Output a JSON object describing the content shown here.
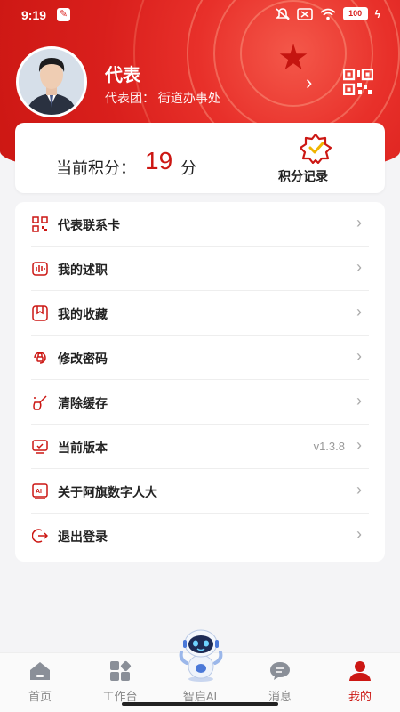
{
  "status_bar": {
    "time": "9:19",
    "battery": "100"
  },
  "profile": {
    "name": "代表",
    "team": "代表团：        街道办事处"
  },
  "points": {
    "label": "当前积分：",
    "value": "19",
    "unit": "分",
    "record_label": "积分记录"
  },
  "menu": {
    "items": [
      {
        "icon": "qr-card-icon",
        "label": "代表联系卡"
      },
      {
        "icon": "audio-wave-icon",
        "label": "我的述职"
      },
      {
        "icon": "bookmark-box-icon",
        "label": "我的收藏"
      },
      {
        "icon": "lock-refresh-icon",
        "label": "修改密码"
      },
      {
        "icon": "broom-icon",
        "label": "清除缓存"
      },
      {
        "icon": "monitor-check-icon",
        "label": "当前版本",
        "value": "v1.3.8"
      },
      {
        "icon": "ai-doc-icon",
        "label": "关于阿旗数字人大"
      },
      {
        "icon": "logout-icon",
        "label": "退出登录"
      }
    ]
  },
  "tabbar": {
    "tabs": [
      {
        "label": "首页",
        "icon": "home-icon"
      },
      {
        "label": "工作台",
        "icon": "grid-icon"
      },
      {
        "label": "智启AI",
        "icon": "robot-icon"
      },
      {
        "label": "消息",
        "icon": "chat-bubble-icon"
      },
      {
        "label": "我的",
        "icon": "person-icon"
      }
    ],
    "active": "我的"
  },
  "colors": {
    "brand": "#cc1713",
    "background": "#f4f4f6"
  }
}
